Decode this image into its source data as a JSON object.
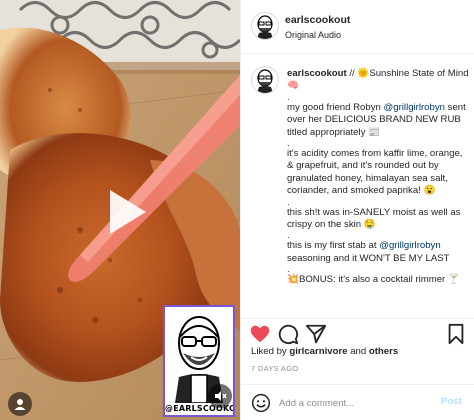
{
  "post": {
    "header": {
      "username": "earlscookout",
      "audio_label": "Original Audio"
    },
    "media": {
      "watermark_text": "@EARLSCOOKOUT",
      "icons": [
        "play-icon",
        "mute-icon",
        "user-tag-icon"
      ]
    },
    "caption": {
      "username": "earlscookout",
      "lines": [
        {
          "pre": " // 🌞Sunshine State of Mind 🧠"
        },
        {
          "dot": "."
        },
        {
          "pre": "my good friend Robyn ",
          "mention": "@grillgirlrobyn",
          "post": " sent over her DELICIOUS BRAND NEW RUB titled appropriately 📰"
        },
        {
          "dot": "."
        },
        {
          "pre": "it's acidity comes from kaffir lime, orange, & grapefruit, and it's rounded out by granulated honey, himalayan sea salt, coriander, and smoked paprika! 😮"
        },
        {
          "dot": "."
        },
        {
          "pre": "this sh!t was in-SANELY moist as well as crispy on the skin 🤤"
        },
        {
          "dot": "."
        },
        {
          "pre": "this is my first stab at ",
          "mention": "@grillgirlrobyn",
          "post": " seasoning and it WON'T BE MY LAST"
        },
        {
          "dot": "."
        },
        {
          "pre": "💥BONUS: it's also a cocktail rimmer 🍸"
        }
      ]
    },
    "actions": {
      "icons": [
        "heart-icon",
        "comment-icon",
        "share-icon",
        "bookmark-icon"
      ],
      "liked": true,
      "like_color": "#ed4956"
    },
    "likes": {
      "prefix": "Liked by ",
      "user": "girlcarnivore",
      "joiner": " and ",
      "others": "others"
    },
    "time_ago": "7 DAYS AGO",
    "comment": {
      "placeholder": "Add a comment...",
      "post_label": "Post"
    },
    "colors": {
      "accent": "#0095f6",
      "mention": "#00376b",
      "border": "#efefef",
      "watermark_border": "#7b55d3"
    }
  }
}
